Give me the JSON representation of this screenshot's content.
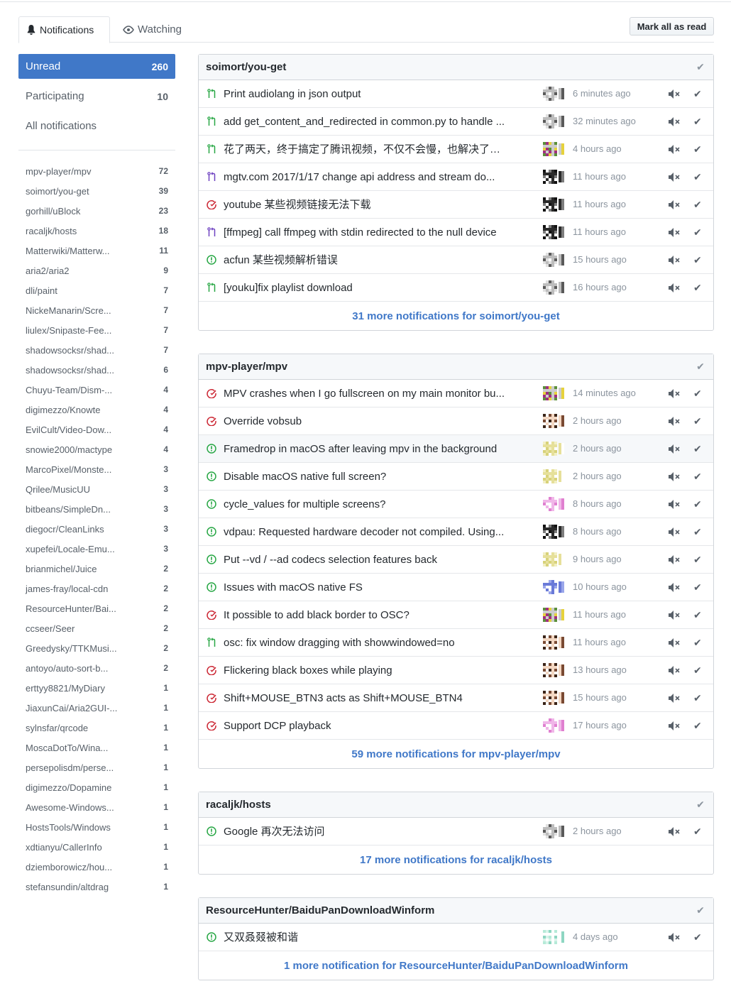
{
  "tabs": {
    "notifications_label": "Notifications",
    "watching_label": "Watching",
    "mark_all_label": "Mark all as read"
  },
  "filters": [
    {
      "label": "Unread",
      "count": "260"
    },
    {
      "label": "Participating",
      "count": "10"
    },
    {
      "label": "All notifications",
      "count": ""
    }
  ],
  "repos": [
    {
      "name": "mpv-player/mpv",
      "count": "72"
    },
    {
      "name": "soimort/you-get",
      "count": "39"
    },
    {
      "name": "gorhill/uBlock",
      "count": "23"
    },
    {
      "name": "racaljk/hosts",
      "count": "18"
    },
    {
      "name": "Matterwiki/Matterw...",
      "count": "11"
    },
    {
      "name": "aria2/aria2",
      "count": "9"
    },
    {
      "name": "dli/paint",
      "count": "7"
    },
    {
      "name": "NickeManarin/Scre...",
      "count": "7"
    },
    {
      "name": "liulex/Snipaste-Fee...",
      "count": "7"
    },
    {
      "name": "shadowsocksr/shad...",
      "count": "7"
    },
    {
      "name": "shadowsocksr/shad...",
      "count": "6"
    },
    {
      "name": "Chuyu-Team/Dism-...",
      "count": "4"
    },
    {
      "name": "digimezzo/Knowte",
      "count": "4"
    },
    {
      "name": "EvilCult/Video-Dow...",
      "count": "4"
    },
    {
      "name": "snowie2000/mactype",
      "count": "4"
    },
    {
      "name": "MarcoPixel/Monste...",
      "count": "3"
    },
    {
      "name": "Qrilee/MusicUU",
      "count": "3"
    },
    {
      "name": "bitbeans/SimpleDn...",
      "count": "3"
    },
    {
      "name": "diegocr/CleanLinks",
      "count": "3"
    },
    {
      "name": "xupefei/Locale-Emu...",
      "count": "3"
    },
    {
      "name": "brianmichel/Juice",
      "count": "2"
    },
    {
      "name": "james-fray/local-cdn",
      "count": "2"
    },
    {
      "name": "ResourceHunter/Bai...",
      "count": "2"
    },
    {
      "name": "ccseer/Seer",
      "count": "2"
    },
    {
      "name": "Greedysky/TTKMusi...",
      "count": "2"
    },
    {
      "name": "antoyo/auto-sort-b...",
      "count": "2"
    },
    {
      "name": "erttyy8821/MyDiary",
      "count": "1"
    },
    {
      "name": "JiaxunCai/Aria2GUI-...",
      "count": "1"
    },
    {
      "name": "sylnsfar/qrcode",
      "count": "1"
    },
    {
      "name": "MoscaDotTo/Wina...",
      "count": "1"
    },
    {
      "name": "persepolisdm/perse...",
      "count": "1"
    },
    {
      "name": "digimezzo/Dopamine",
      "count": "1"
    },
    {
      "name": "Awesome-Windows...",
      "count": "1"
    },
    {
      "name": "HostsTools/Windows",
      "count": "1"
    },
    {
      "name": "xdtianyu/CallerInfo",
      "count": "1"
    },
    {
      "name": "dziemborowicz/hou...",
      "count": "1"
    },
    {
      "name": "stefansundin/altdrag",
      "count": "1"
    }
  ],
  "groups": [
    {
      "repo": "soimort/you-get",
      "more": "31 more notifications for soimort/you-get",
      "items": [
        {
          "type": "pr-open",
          "title": "Print audiolang in json output",
          "time": "6 minutes ago",
          "avatar": "pixel-gray"
        },
        {
          "type": "pr-open",
          "title": "add get_content_and_redirected in common.py to handle ...",
          "time": "32 minutes ago",
          "avatar": "pixel-gray"
        },
        {
          "type": "pr-open",
          "title": "花了两天，终于搞定了腾讯视频，不仅不会慢，也解决了之前...",
          "time": "4 hours ago",
          "avatar": "pixel-color"
        },
        {
          "type": "pr-merged",
          "title": "mgtv.com 2017/1/17 change api address and stream do...",
          "time": "11 hours ago",
          "avatar": "pixel-dark"
        },
        {
          "type": "issue-closed",
          "title": "youtube 某些视频链接无法下载",
          "time": "11 hours ago",
          "avatar": "pixel-dark"
        },
        {
          "type": "pr-merged",
          "title": "[ffmpeg] call ffmpeg with stdin redirected to the null device",
          "time": "11 hours ago",
          "avatar": "pixel-dark"
        },
        {
          "type": "issue-open",
          "title": "acfun 某些视频解析错误",
          "time": "15 hours ago",
          "avatar": "pixel-gray"
        },
        {
          "type": "pr-open",
          "title": "[youku]fix playlist download",
          "time": "16 hours ago",
          "avatar": "pixel-gray"
        }
      ]
    },
    {
      "repo": "mpv-player/mpv",
      "more": "59 more notifications for mpv-player/mpv",
      "items": [
        {
          "type": "issue-closed",
          "title": "MPV crashes when I go fullscreen on my main monitor bu...",
          "time": "14 minutes ago",
          "avatar": "pixel-color"
        },
        {
          "type": "issue-closed",
          "title": "Override vobsub",
          "time": "2 hours ago",
          "avatar": "pixel-anime"
        },
        {
          "type": "issue-open",
          "title": "Framedrop in macOS after leaving mpv in the background",
          "time": "2 hours ago",
          "avatar": "pixel-yellow"
        },
        {
          "type": "issue-open",
          "title": "Disable macOS native full screen?",
          "time": "2 hours ago",
          "avatar": "pixel-yellow"
        },
        {
          "type": "issue-open",
          "title": "cycle_values for multiple screens?",
          "time": "8 hours ago",
          "avatar": "pixel-pink"
        },
        {
          "type": "issue-open",
          "title": "vdpau: Requested hardware decoder not compiled. Using...",
          "time": "8 hours ago",
          "avatar": "pixel-dark"
        },
        {
          "type": "issue-open",
          "title": "Put --vd / --ad codecs selection features back",
          "time": "9 hours ago",
          "avatar": "pixel-yellow"
        },
        {
          "type": "issue-open",
          "title": "Issues with macOS native FS",
          "time": "10 hours ago",
          "avatar": "pixel-blue"
        },
        {
          "type": "issue-closed",
          "title": "It possible to add black border to OSC?",
          "time": "11 hours ago",
          "avatar": "pixel-color"
        },
        {
          "type": "pr-open",
          "title": "osc: fix window dragging with showwindowed=no",
          "time": "11 hours ago",
          "avatar": "pixel-anime"
        },
        {
          "type": "issue-closed",
          "title": "Flickering black boxes while playing",
          "time": "13 hours ago",
          "avatar": "pixel-anime"
        },
        {
          "type": "issue-closed",
          "title": "Shift+MOUSE_BTN3 acts as Shift+MOUSE_BTN4",
          "time": "15 hours ago",
          "avatar": "pixel-anime"
        },
        {
          "type": "issue-closed",
          "title": "Support DCP playback",
          "time": "17 hours ago",
          "avatar": "pixel-pink"
        }
      ]
    },
    {
      "repo": "racaljk/hosts",
      "more": "17 more notifications for racaljk/hosts",
      "items": [
        {
          "type": "issue-open",
          "title": "Google 再次无法访问",
          "time": "2 hours ago",
          "avatar": "pixel-gray"
        }
      ]
    },
    {
      "repo": "ResourceHunter/BaiduPanDownloadWinform",
      "more": "1 more notification for ResourceHunter/BaiduPanDownloadWinform",
      "items": [
        {
          "type": "issue-open",
          "title": "又双叒叕被和谐",
          "time": "4 days ago",
          "avatar": "pixel-teal"
        }
      ]
    }
  ],
  "colors": {
    "accent": "#4078c8",
    "open_green": "#28a745",
    "closed_red": "#cb2431",
    "merged_purple": "#6f42c1"
  }
}
